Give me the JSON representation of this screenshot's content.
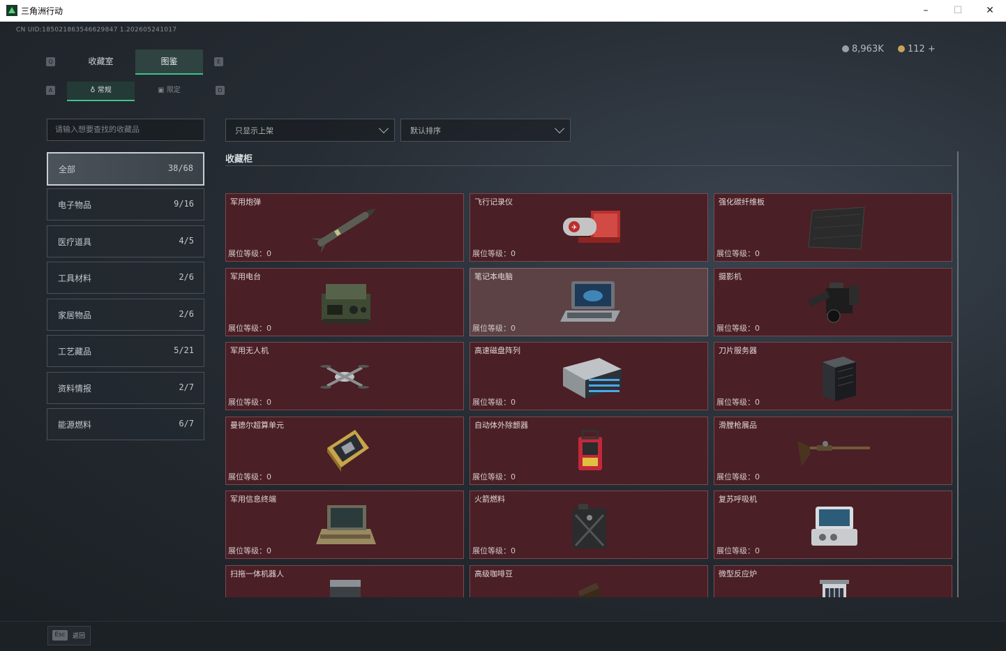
{
  "window": {
    "title": "三角洲行动",
    "min": "–",
    "max": "☐",
    "close": "✕"
  },
  "header": {
    "uid": "CN UID:185021863546629847 1.202605241017"
  },
  "currency": [
    {
      "value": "8,963K",
      "icon": "silver-coin-icon"
    },
    {
      "value": "112 +",
      "icon": "gold-coin-icon"
    }
  ],
  "keys": {
    "tab_left": "Q",
    "tab_right": "E",
    "sub_left": "A",
    "sub_right": "D"
  },
  "tabs": {
    "main": [
      "收藏室",
      "图鉴"
    ],
    "active_main": 1,
    "sub": [
      "常规",
      "限定"
    ],
    "active_sub": 0
  },
  "search": {
    "placeholder": "请输入想要查找的收藏品"
  },
  "filters": {
    "shelf": "只显示上架",
    "sort": "默认排序"
  },
  "categories": [
    {
      "name": "全部",
      "count": "38/68"
    },
    {
      "name": "电子物品",
      "count": "9/16"
    },
    {
      "name": "医疗道具",
      "count": "4/5"
    },
    {
      "name": "工具材料",
      "count": "2/6"
    },
    {
      "name": "家居物品",
      "count": "2/6"
    },
    {
      "name": "工艺藏品",
      "count": "5/21"
    },
    {
      "name": "资料情报",
      "count": "2/7"
    },
    {
      "name": "能源燃料",
      "count": "6/7"
    }
  ],
  "section_title": "收藏柜",
  "level_label": "展位等级：",
  "items": [
    {
      "name": "军用炮弹",
      "level": "0",
      "icon": "missile-icon"
    },
    {
      "name": "飞行记录仪",
      "level": "0",
      "icon": "flight-recorder-icon"
    },
    {
      "name": "强化碳纤维板",
      "level": "0",
      "icon": "carbon-plate-icon"
    },
    {
      "name": "军用电台",
      "level": "0",
      "icon": "military-radio-icon"
    },
    {
      "name": "笔记本电脑",
      "level": "0",
      "icon": "laptop-icon"
    },
    {
      "name": "摄影机",
      "level": "0",
      "icon": "camera-icon"
    },
    {
      "name": "军用无人机",
      "level": "0",
      "icon": "drone-icon"
    },
    {
      "name": "高速磁盘阵列",
      "level": "0",
      "icon": "disk-array-icon"
    },
    {
      "name": "刀片服务器",
      "level": "0",
      "icon": "blade-server-icon"
    },
    {
      "name": "曼德尔超算单元",
      "level": "0",
      "icon": "cpu-unit-icon"
    },
    {
      "name": "自动体外除颤器",
      "level": "0",
      "icon": "defibrillator-icon"
    },
    {
      "name": "滑膛枪展品",
      "level": "0",
      "icon": "musket-icon"
    },
    {
      "name": "军用信息终端",
      "level": "0",
      "icon": "info-terminal-icon"
    },
    {
      "name": "火箭燃料",
      "level": "0",
      "icon": "fuel-can-icon"
    },
    {
      "name": "复苏呼吸机",
      "level": "0",
      "icon": "ventilator-icon"
    },
    {
      "name": "扫拖一体机器人",
      "level": "",
      "icon": "robot-vacuum-icon"
    },
    {
      "name": "高级咖啡豆",
      "level": "",
      "icon": "coffee-bag-icon"
    },
    {
      "name": "微型反应炉",
      "level": "",
      "icon": "reactor-icon"
    }
  ],
  "footer": {
    "esc_key": "Esc",
    "back": "返回"
  }
}
